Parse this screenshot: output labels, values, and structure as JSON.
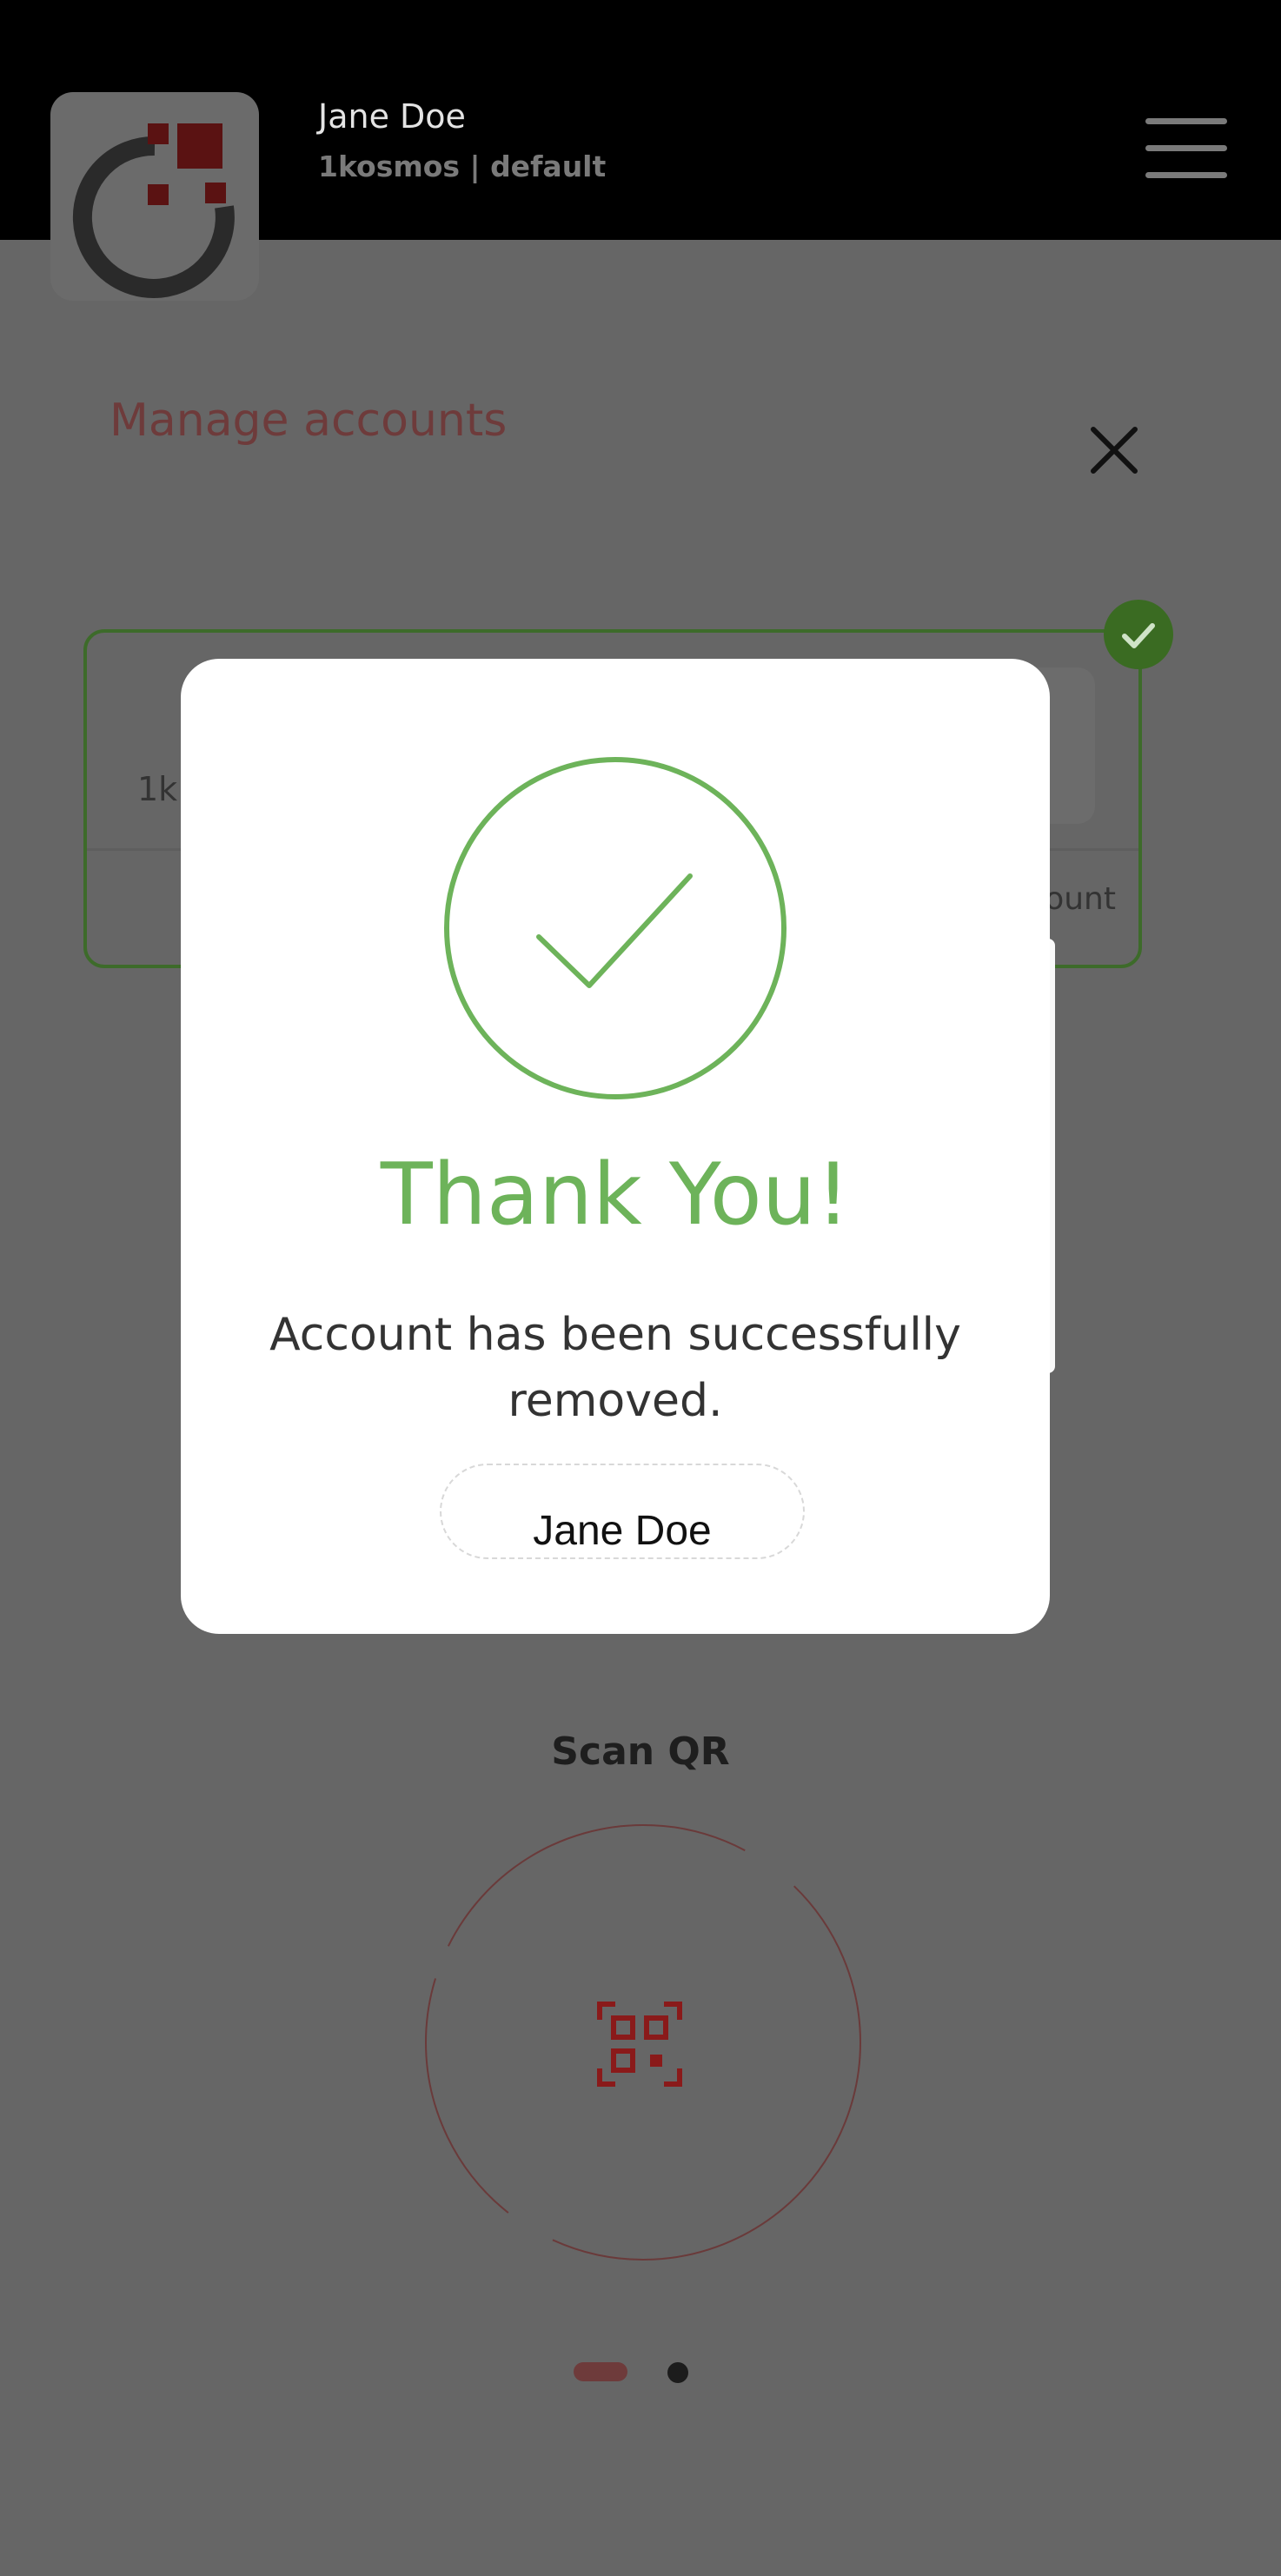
{
  "header": {
    "user_name": "Jane Doe",
    "org_line": "1kosmos | default"
  },
  "manage": {
    "title": "Manage accounts"
  },
  "account_card": {
    "org_partial": "1k",
    "action_partial": "ount"
  },
  "scan": {
    "label": "Scan QR"
  },
  "modal": {
    "title": "Thank You!",
    "message": "Account has been successfully removed.",
    "name_button": "Jane Doe"
  },
  "colors": {
    "success_green": "#6db35a",
    "brand_red": "#b01c1c",
    "overlay_gray": "#666666"
  }
}
